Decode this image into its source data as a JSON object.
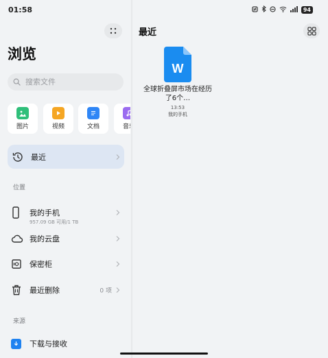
{
  "status_bar": {
    "time": "01:58",
    "icons": [
      "nfc-icon",
      "bluetooth-icon",
      "dnd-icon",
      "wifi-icon",
      "signal-icon"
    ],
    "battery": "94"
  },
  "left_pane": {
    "title": "浏览",
    "search": {
      "placeholder": "搜索文件"
    },
    "categories": [
      {
        "label": "图片",
        "icon": "image-icon",
        "color": "#2fbf7a"
      },
      {
        "label": "视频",
        "icon": "video-icon",
        "color": "#f5a623"
      },
      {
        "label": "文档",
        "icon": "document-icon",
        "color": "#2f86f6"
      },
      {
        "label": "音乐",
        "icon": "music-icon",
        "color": "#9b6cf0"
      }
    ],
    "recent": {
      "label": "最近"
    },
    "locations_header": "位置",
    "locations": [
      {
        "label": "我的手机",
        "sub": "957.09 GB 可用/1 TB",
        "icon": "phone-icon"
      },
      {
        "label": "我的云盘",
        "icon": "cloud-icon"
      },
      {
        "label": "保密柜",
        "icon": "safe-icon"
      },
      {
        "label": "最近删除",
        "count": "0 项",
        "icon": "trash-icon"
      }
    ],
    "sources_header": "来源",
    "sources": [
      {
        "label": "下载与接收",
        "icon": "download-icon"
      }
    ]
  },
  "right_pane": {
    "title": "最近",
    "files": [
      {
        "name": "全球折叠屏市场在经历了6个…",
        "time": "13:53",
        "location": "我的手机",
        "icon": "word-doc-icon",
        "icon_letter": "W"
      }
    ]
  },
  "colors": {
    "accent": "#2f86f6",
    "selected_bg": "#dde6f3",
    "background": "#f1f3f5"
  }
}
